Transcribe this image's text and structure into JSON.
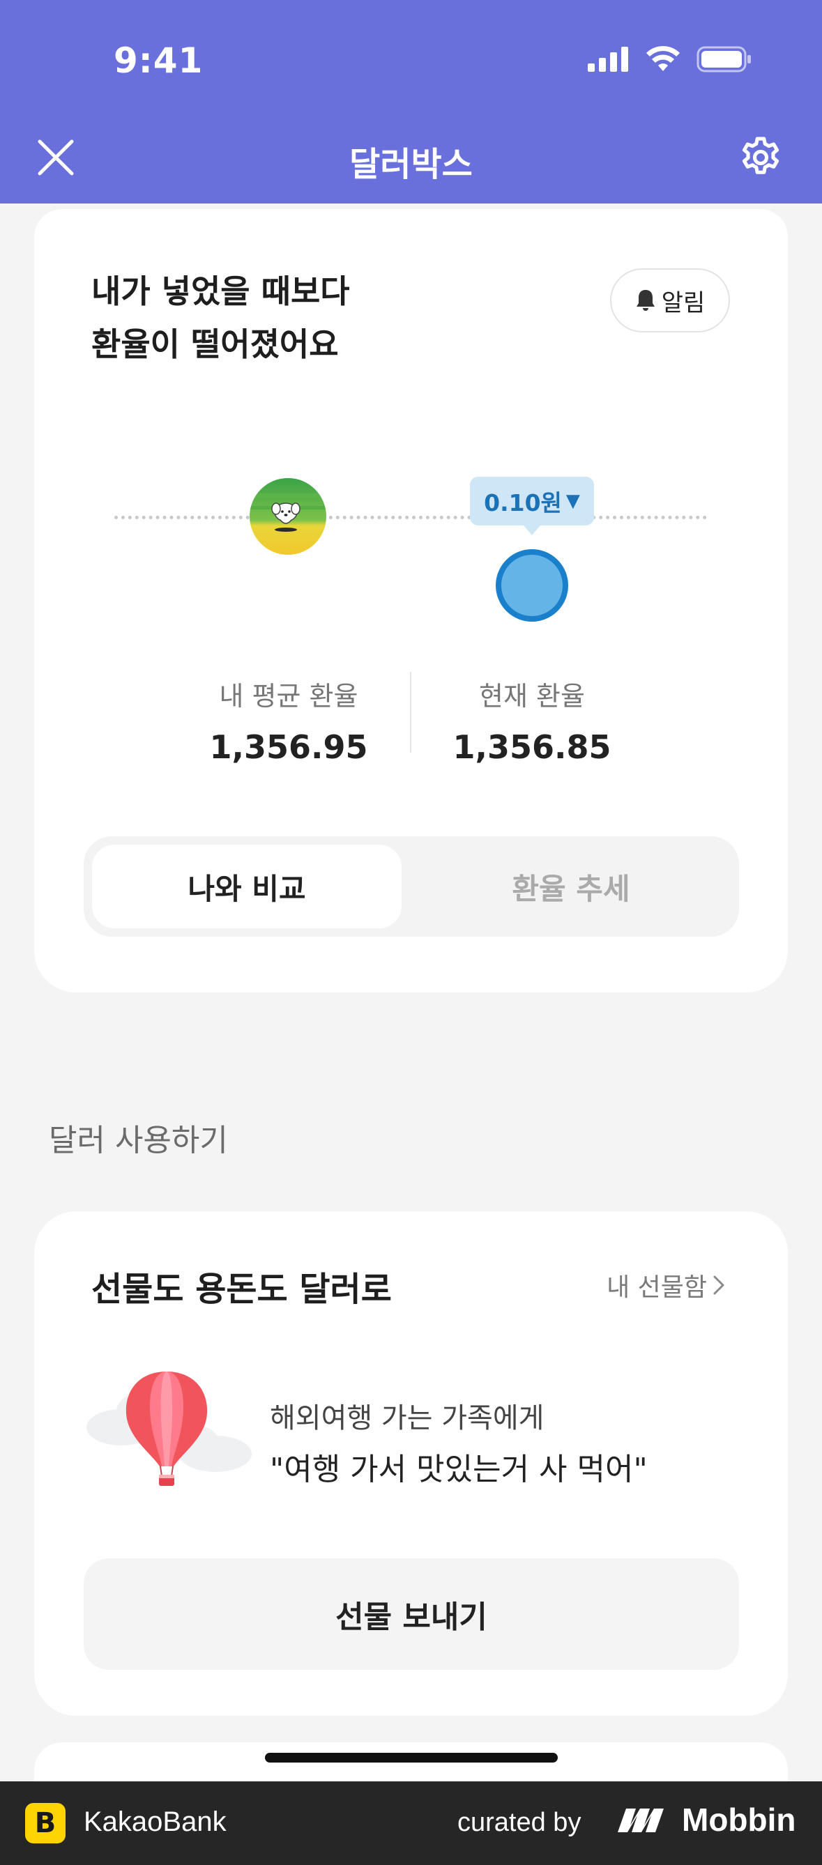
{
  "status_bar": {
    "time": "9:41"
  },
  "nav": {
    "title": "달러박스"
  },
  "rate_card": {
    "headline_line1": "내가 넣었을 때보다",
    "headline_line2": "환율이 떨어졌어요",
    "alarm_label": "알림",
    "diff_label": "0.10원",
    "diff_arrow": "▼",
    "avg_label": "내 평균 환율",
    "avg_value": "1,356.95",
    "current_label": "현재 환율",
    "current_value": "1,356.85",
    "tabs": [
      "나와 비교",
      "환율 추세"
    ],
    "active_tab": 0
  },
  "section": {
    "title": "달러 사용하기"
  },
  "gift_card": {
    "title": "선물도 용돈도 달러로",
    "gift_box_link": "내 선물함",
    "line1": "해외여행 가는 가족에게",
    "line2": "\"여행 가서 맛있는거 사 먹어\"",
    "button": "선물 보내기"
  },
  "footer": {
    "logo_letter": "B",
    "app_name": "KakaoBank",
    "curated_by": "curated by",
    "brand": "Mobbin"
  },
  "colors": {
    "header_bg": "#6970dc",
    "diff_badge_bg": "#cfe6f7",
    "diff_text": "#1c72b6",
    "current_dot": "#64b4e8",
    "footer_bg": "#262626",
    "kakao_yellow": "#ffd400"
  }
}
